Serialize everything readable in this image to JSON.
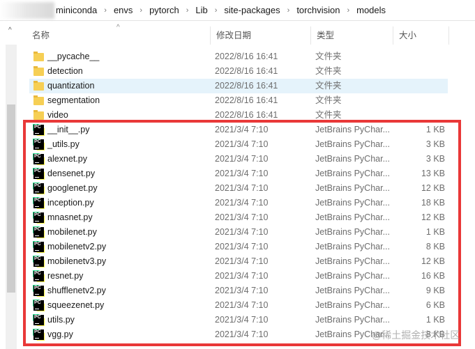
{
  "breadcrumb": [
    "miniconda",
    "envs",
    "pytorch",
    "Lib",
    "site-packages",
    "torchvision",
    "models"
  ],
  "columns": {
    "name": "名称",
    "date": "修改日期",
    "type": "类型",
    "size": "大小"
  },
  "folders": [
    {
      "name": "__pycache__",
      "date": "2022/8/16 16:41",
      "type": "文件夹"
    },
    {
      "name": "detection",
      "date": "2022/8/16 16:41",
      "type": "文件夹"
    },
    {
      "name": "quantization",
      "date": "2022/8/16 16:41",
      "type": "文件夹"
    },
    {
      "name": "segmentation",
      "date": "2022/8/16 16:41",
      "type": "文件夹"
    },
    {
      "name": "video",
      "date": "2022/8/16 16:41",
      "type": "文件夹"
    }
  ],
  "files": [
    {
      "name": "__init__.py",
      "date": "2021/3/4 7:10",
      "type": "JetBrains PyChar...",
      "size": "1 KB"
    },
    {
      "name": "_utils.py",
      "date": "2021/3/4 7:10",
      "type": "JetBrains PyChar...",
      "size": "3 KB"
    },
    {
      "name": "alexnet.py",
      "date": "2021/3/4 7:10",
      "type": "JetBrains PyChar...",
      "size": "3 KB"
    },
    {
      "name": "densenet.py",
      "date": "2021/3/4 7:10",
      "type": "JetBrains PyChar...",
      "size": "13 KB"
    },
    {
      "name": "googlenet.py",
      "date": "2021/3/4 7:10",
      "type": "JetBrains PyChar...",
      "size": "12 KB"
    },
    {
      "name": "inception.py",
      "date": "2021/3/4 7:10",
      "type": "JetBrains PyChar...",
      "size": "18 KB"
    },
    {
      "name": "mnasnet.py",
      "date": "2021/3/4 7:10",
      "type": "JetBrains PyChar...",
      "size": "12 KB"
    },
    {
      "name": "mobilenet.py",
      "date": "2021/3/4 7:10",
      "type": "JetBrains PyChar...",
      "size": "1 KB"
    },
    {
      "name": "mobilenetv2.py",
      "date": "2021/3/4 7:10",
      "type": "JetBrains PyChar...",
      "size": "8 KB"
    },
    {
      "name": "mobilenetv3.py",
      "date": "2021/3/4 7:10",
      "type": "JetBrains PyChar...",
      "size": "12 KB"
    },
    {
      "name": "resnet.py",
      "date": "2021/3/4 7:10",
      "type": "JetBrains PyChar...",
      "size": "16 KB"
    },
    {
      "name": "shufflenetv2.py",
      "date": "2021/3/4 7:10",
      "type": "JetBrains PyChar...",
      "size": "9 KB"
    },
    {
      "name": "squeezenet.py",
      "date": "2021/3/4 7:10",
      "type": "JetBrains PyChar...",
      "size": "6 KB"
    },
    {
      "name": "utils.py",
      "date": "2021/3/4 7:10",
      "type": "JetBrains PyChar...",
      "size": "1 KB"
    },
    {
      "name": "vgg.py",
      "date": "2021/3/4 7:10",
      "type": "JetBrains PyChar...",
      "size": "8 KB"
    }
  ],
  "icon_text": "PC",
  "watermark": "@稀土掘金技术社区",
  "selected_folder": "quantization"
}
